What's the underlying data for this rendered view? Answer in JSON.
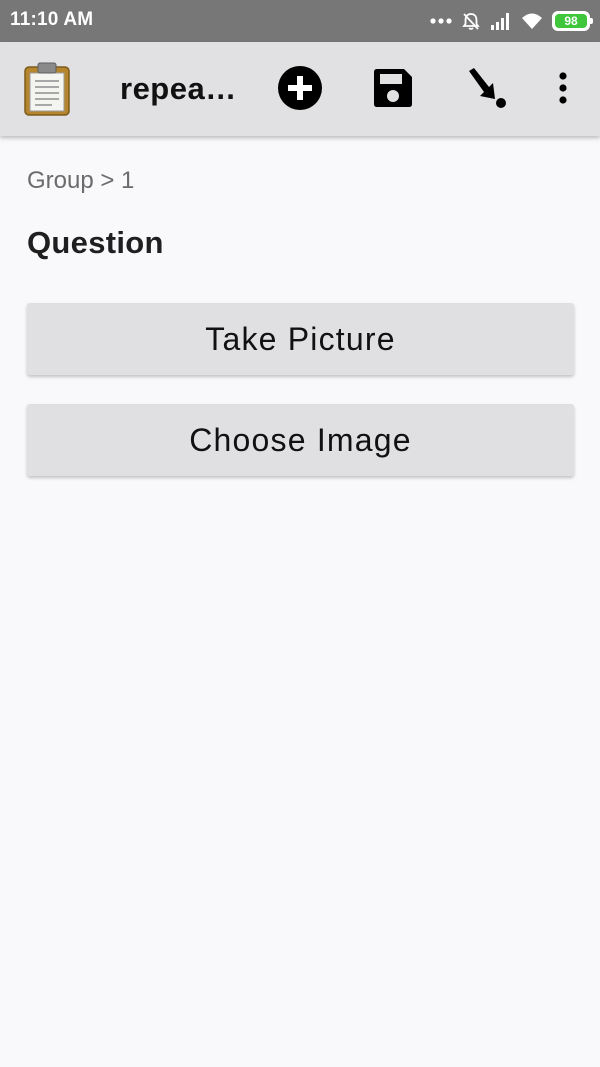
{
  "status_bar": {
    "time": "11:10 AM",
    "battery_level": "98",
    "battery_color": "#3fc63b",
    "icons": [
      "more-dots-icon",
      "alarm-off-icon",
      "signal-icon",
      "wifi-icon",
      "battery-icon"
    ]
  },
  "toolbar": {
    "app_icon": "clipboard-icon",
    "title": "repea…",
    "actions": [
      {
        "name": "add-repeat-button",
        "icon": "add-circle-icon"
      },
      {
        "name": "save-button",
        "icon": "save-icon"
      },
      {
        "name": "jump-button",
        "icon": "arrow-jump-icon"
      },
      {
        "name": "overflow-menu-button",
        "icon": "more-vert-icon"
      }
    ]
  },
  "form": {
    "breadcrumb": "Group > 1",
    "question": "Question",
    "take_picture_label": "Take Picture",
    "choose_image_label": "Choose Image"
  }
}
